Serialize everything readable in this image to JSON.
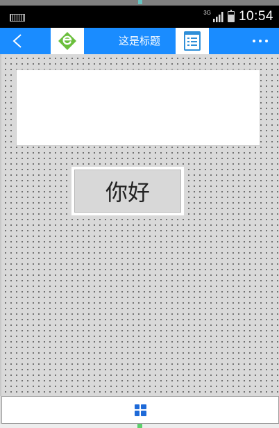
{
  "status_bar": {
    "network_type": "3G",
    "time": "10:54",
    "icons": [
      "keyboard-icon",
      "signal-icon",
      "battery-icon"
    ]
  },
  "title_bar": {
    "title": "这是标题",
    "back_icon": "chevron-left-icon",
    "logo_icon": "evernote-logo-icon",
    "doc_icon": "document-list-icon",
    "more_icon": "more-dots-icon",
    "colors": {
      "bar": "#1a8cff",
      "logo_green": "#6bbf3c"
    }
  },
  "main": {
    "text_area_value": "",
    "hello_button_label": "你好"
  },
  "bottom_bar": {
    "icon": "grid-apps-icon",
    "icon_color": "#1e6ad8"
  }
}
